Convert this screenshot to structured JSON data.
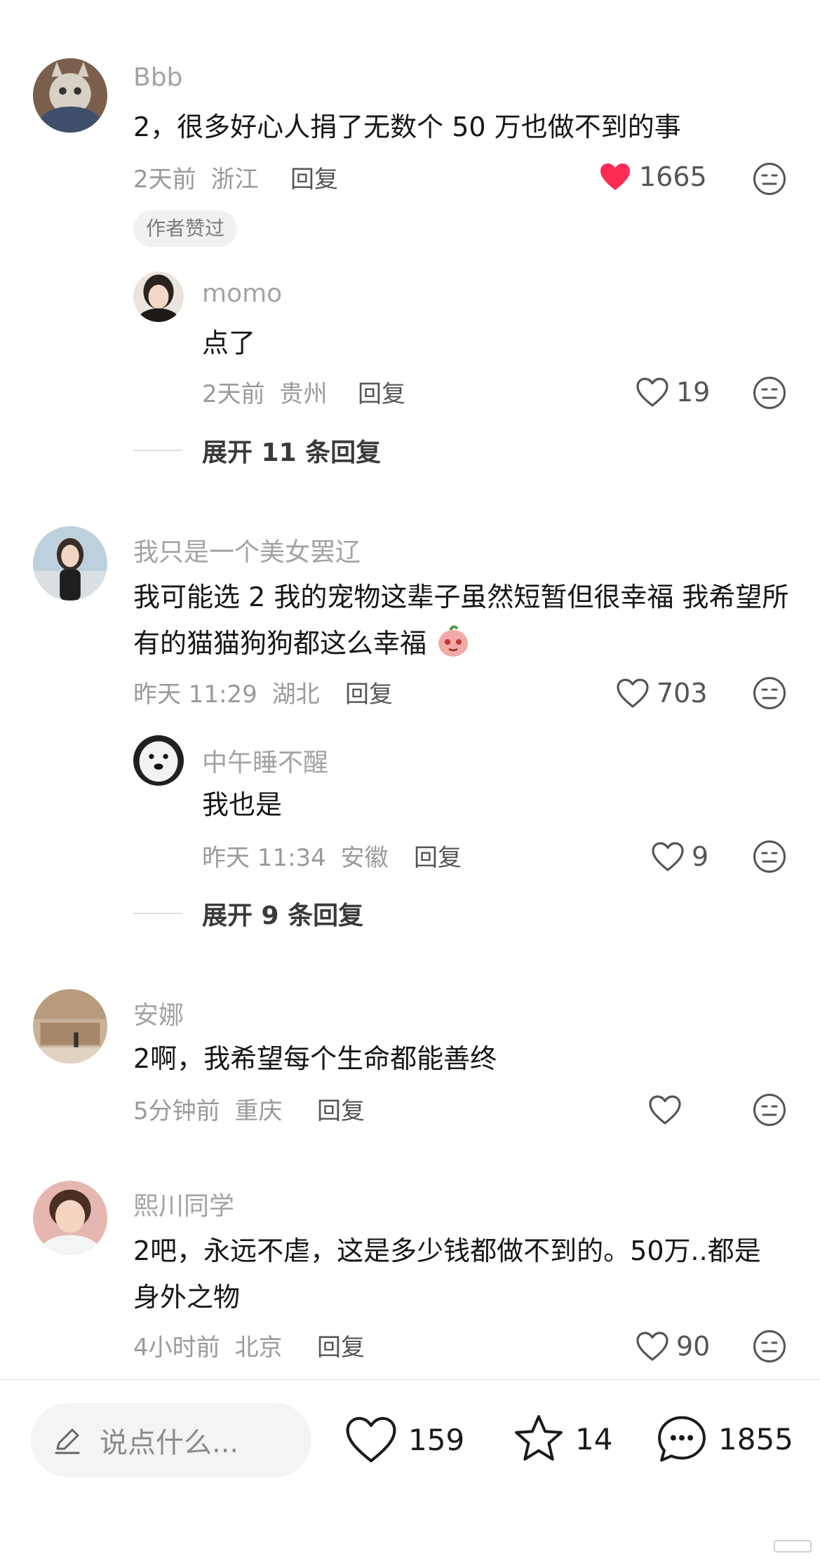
{
  "comments": [
    {
      "username": "Bbb",
      "text": "2，很多好心人捐了无数个 50 万也做不到的事",
      "time": "2天前",
      "location": "浙江",
      "reply_label": "回复",
      "likes": "1665",
      "liked": true,
      "badge": "作者赞过",
      "reply": {
        "username": "momo",
        "text": "点了",
        "time": "2天前",
        "location": "贵州",
        "reply_label": "回复",
        "likes": "19"
      },
      "expand_label": "展开 11 条回复"
    },
    {
      "username": "我只是一个美女罢辽",
      "text": "我可能选 2 我的宠物这辈子虽然短暂但很幸福 我希望所有的猫猫狗狗都这么幸福",
      "time": "昨天 11:29",
      "location": "湖北",
      "reply_label": "回复",
      "likes": "703",
      "reply": {
        "username": "中午睡不醒",
        "text": "我也是",
        "time": "昨天 11:34",
        "location": "安徽",
        "reply_label": "回复",
        "likes": "9"
      },
      "expand_label": "展开 9 条回复"
    },
    {
      "username": "安娜",
      "text": "2啊，我希望每个生命都能善终",
      "time": "5分钟前",
      "location": "重庆",
      "reply_label": "回复",
      "likes": ""
    },
    {
      "username": "熙川同学",
      "text": "2吧，永远不虐，这是多少钱都做不到的。50万..都是身外之物",
      "time": "4小时前",
      "location": "北京",
      "reply_label": "回复",
      "likes": "90"
    }
  ],
  "bottom_bar": {
    "input_placeholder": "说点什么...",
    "like_count": "159",
    "favorite_count": "14",
    "comment_count": "1855"
  },
  "colors": {
    "liked_heart": "#fe2c55",
    "muted_text": "#9a9a9a"
  },
  "icons": [
    "heart-icon",
    "heart-filled-icon",
    "dislike-face-icon",
    "pencil-icon",
    "star-icon",
    "comment-bubble-icon"
  ]
}
